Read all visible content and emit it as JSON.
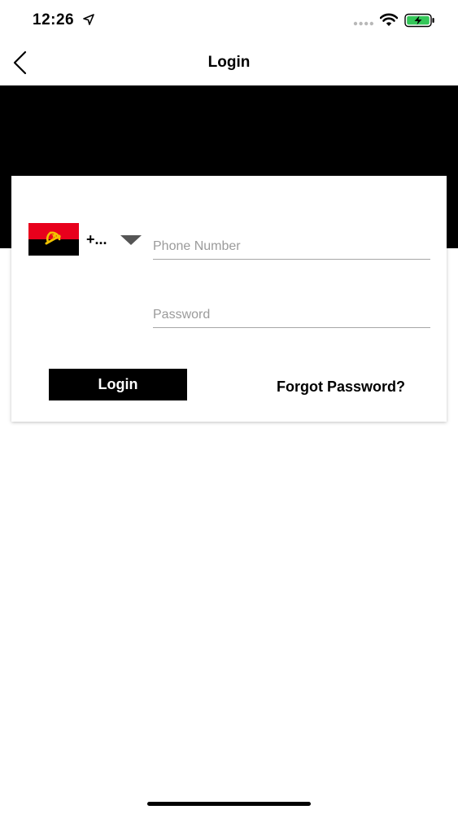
{
  "status_bar": {
    "time": "12:26",
    "icons": [
      "location-arrow-icon",
      "signal-dots-icon",
      "wifi-icon",
      "battery-charging-icon"
    ]
  },
  "nav": {
    "title": "Login",
    "back_icon": "chevron-left-icon"
  },
  "colors": {
    "header_band": "#000000",
    "button": "#000000",
    "battery_fill": "#34c759",
    "flag_red": "#e8001c",
    "flag_black": "#000000",
    "flag_emblem": "#f2c200"
  },
  "login_form": {
    "country": {
      "flag_icon": "angola-flag-icon",
      "code": "+...",
      "dropdown_icon": "chevron-down-icon"
    },
    "phone": {
      "placeholder": "Phone Number",
      "value": ""
    },
    "password": {
      "placeholder": "Password",
      "value": ""
    },
    "login_label": "Login",
    "forgot_label": "Forgot Password?"
  }
}
